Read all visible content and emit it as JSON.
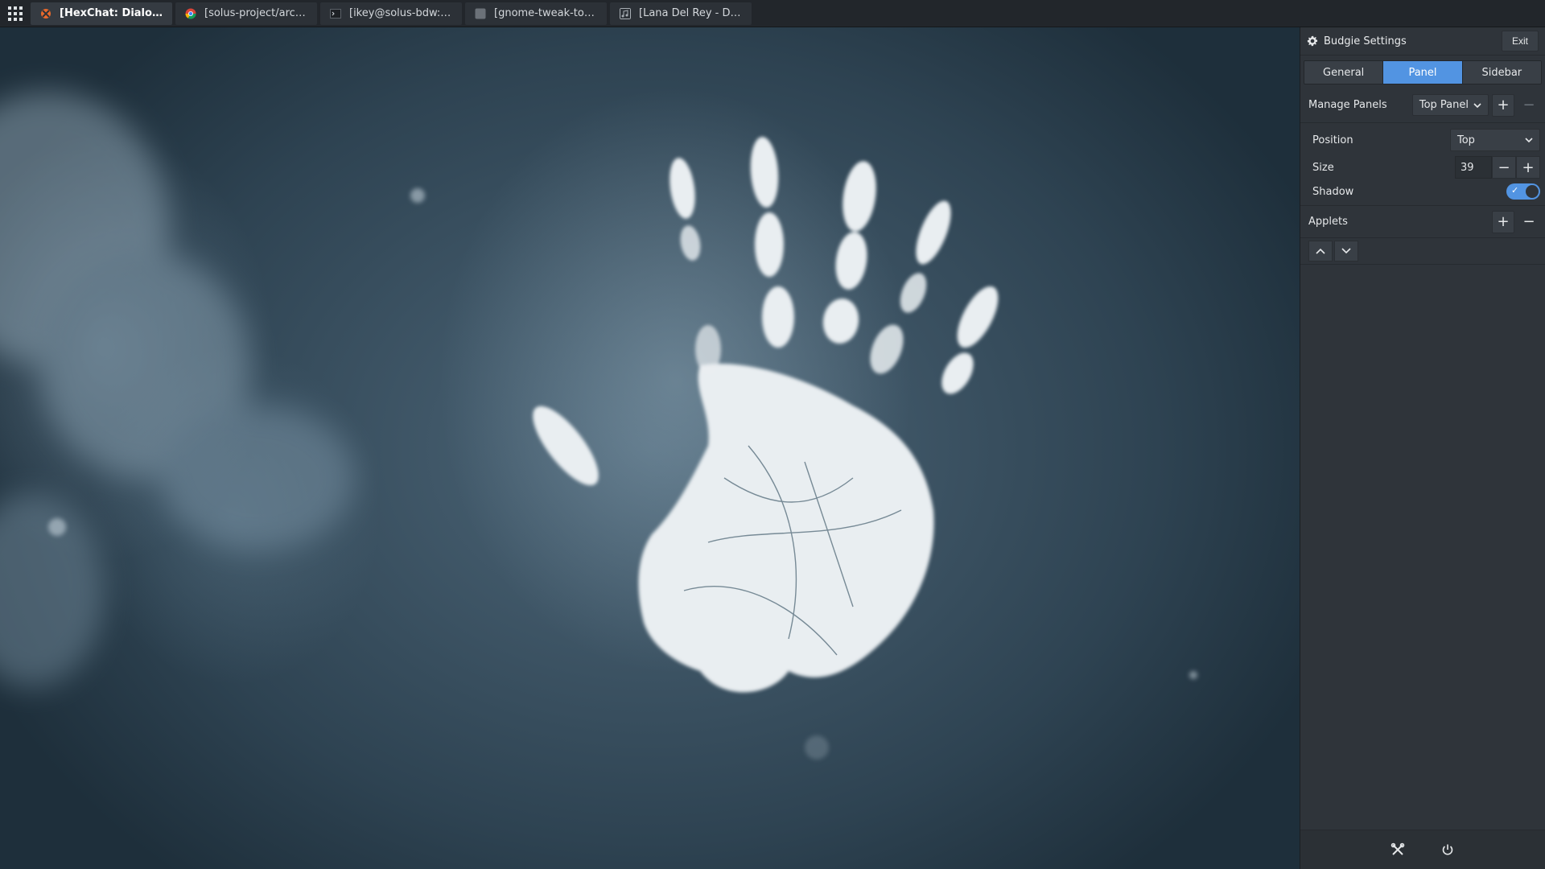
{
  "top_panel": {
    "tasks": [
      {
        "label": "[HexChat: Dialogue ...",
        "icon": "hexchat-icon",
        "active": true
      },
      {
        "label": "[solus-project/arc-d...",
        "icon": "chrome-icon",
        "active": false
      },
      {
        "label": "[ikey@solus-bdw:~]",
        "icon": "terminal-icon",
        "active": false
      },
      {
        "label": "[gnome-tweak-tool]",
        "icon": "tweak-tool-icon",
        "active": false
      },
      {
        "label": "[Lana Del Rey - Dar...",
        "icon": "music-player-icon",
        "active": false
      }
    ]
  },
  "sidebar": {
    "title": "Budgie Settings",
    "exit_label": "Exit",
    "tabs": [
      "General",
      "Panel",
      "Sidebar"
    ],
    "active_tab": "Panel",
    "manage_panels_label": "Manage Panels",
    "selected_panel": "Top Panel",
    "position_label": "Position",
    "position_value": "Top",
    "size_label": "Size",
    "size_value": "39",
    "shadow_label": "Shadow",
    "shadow_enabled": true,
    "applets_label": "Applets"
  },
  "colors": {
    "accent": "#5294e2",
    "panel_bg": "#22262b",
    "sidebar_bg": "#2f343a"
  }
}
